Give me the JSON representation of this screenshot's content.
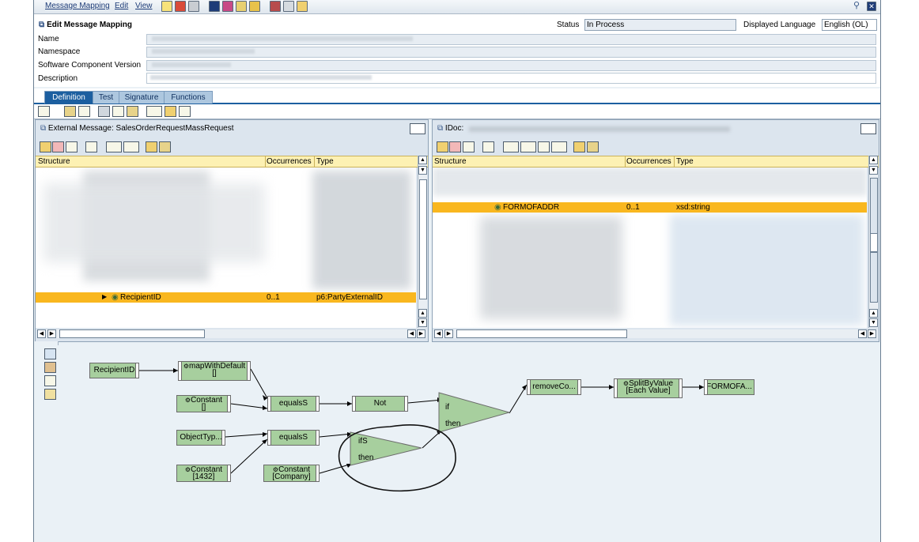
{
  "menubar": {
    "items": [
      "Message Mapping",
      "Edit",
      "View"
    ],
    "toolbar_icons": [
      "edit-icon",
      "save-icon",
      "copy-icon",
      "info-icon",
      "activate-icon",
      "hierarchy-icon",
      "where-used-icon",
      "print-icon",
      "table-icon",
      "help-icon"
    ],
    "right_icons": [
      "pin-icon",
      "close-icon"
    ]
  },
  "header": {
    "title": "Edit Message Mapping",
    "fields": {
      "name_label": "Name",
      "namespace_label": "Namespace",
      "swcv_label": "Software Component Version",
      "description_label": "Description"
    },
    "status_label": "Status",
    "status_value": "In Process",
    "language_label": "Displayed Language",
    "language_value": "English (OL)"
  },
  "tabs": [
    "Definition",
    "Test",
    "Signature",
    "Functions"
  ],
  "source_pane": {
    "title": "External Message: SalesOrderRequestMassRequest",
    "columns": [
      "Structure",
      "Occurrences",
      "Type"
    ],
    "selected_row": {
      "structure": "RecipientID",
      "occurrences": "0..1",
      "type": "p6:PartyExternalID"
    }
  },
  "target_pane": {
    "title": "IDoc:",
    "columns": [
      "Structure",
      "Occurrences",
      "Type"
    ],
    "selected_row": {
      "structure": "FORMOFADDR",
      "occurrences": "0..1",
      "type": "xsd:string"
    }
  },
  "mapping": {
    "nodes": {
      "recipient": "RecipientID",
      "map_with_default": "mapWithDefault",
      "map_with_default_sub": "[]",
      "const1": "Constant",
      "const1_sub": "[]",
      "equals1": "equalsS",
      "not": "Not",
      "if_top": "if",
      "if_then": "then",
      "remove": "removeCo...",
      "split": "SplitByValue",
      "split_sub": "[Each Value]",
      "target": "FORMOFA...",
      "objtype": "ObjectTyp...",
      "equals2": "equalsS",
      "ifs_top": "ifS",
      "ifs_then": "then",
      "const2": "Constant",
      "const2_sub": "[1432]",
      "const3": "Constant",
      "const3_sub": "[Company]"
    }
  }
}
